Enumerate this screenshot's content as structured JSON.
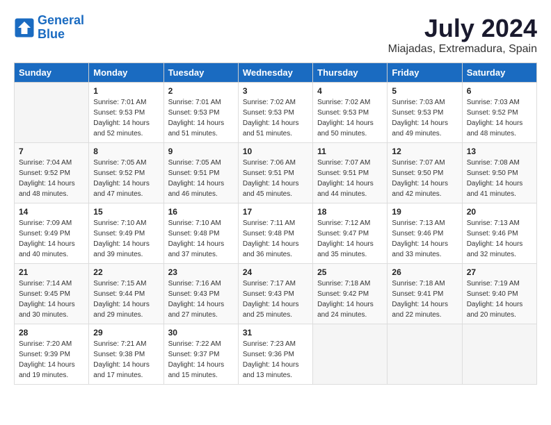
{
  "logo": {
    "line1": "General",
    "line2": "Blue"
  },
  "title": "July 2024",
  "subtitle": "Miajadas, Extremadura, Spain",
  "days_of_week": [
    "Sunday",
    "Monday",
    "Tuesday",
    "Wednesday",
    "Thursday",
    "Friday",
    "Saturday"
  ],
  "weeks": [
    [
      {
        "day": "",
        "sunrise": "",
        "sunset": "",
        "daylight": ""
      },
      {
        "day": "1",
        "sunrise": "Sunrise: 7:01 AM",
        "sunset": "Sunset: 9:53 PM",
        "daylight": "Daylight: 14 hours and 52 minutes."
      },
      {
        "day": "2",
        "sunrise": "Sunrise: 7:01 AM",
        "sunset": "Sunset: 9:53 PM",
        "daylight": "Daylight: 14 hours and 51 minutes."
      },
      {
        "day": "3",
        "sunrise": "Sunrise: 7:02 AM",
        "sunset": "Sunset: 9:53 PM",
        "daylight": "Daylight: 14 hours and 51 minutes."
      },
      {
        "day": "4",
        "sunrise": "Sunrise: 7:02 AM",
        "sunset": "Sunset: 9:53 PM",
        "daylight": "Daylight: 14 hours and 50 minutes."
      },
      {
        "day": "5",
        "sunrise": "Sunrise: 7:03 AM",
        "sunset": "Sunset: 9:53 PM",
        "daylight": "Daylight: 14 hours and 49 minutes."
      },
      {
        "day": "6",
        "sunrise": "Sunrise: 7:03 AM",
        "sunset": "Sunset: 9:52 PM",
        "daylight": "Daylight: 14 hours and 48 minutes."
      }
    ],
    [
      {
        "day": "7",
        "sunrise": "Sunrise: 7:04 AM",
        "sunset": "Sunset: 9:52 PM",
        "daylight": "Daylight: 14 hours and 48 minutes."
      },
      {
        "day": "8",
        "sunrise": "Sunrise: 7:05 AM",
        "sunset": "Sunset: 9:52 PM",
        "daylight": "Daylight: 14 hours and 47 minutes."
      },
      {
        "day": "9",
        "sunrise": "Sunrise: 7:05 AM",
        "sunset": "Sunset: 9:51 PM",
        "daylight": "Daylight: 14 hours and 46 minutes."
      },
      {
        "day": "10",
        "sunrise": "Sunrise: 7:06 AM",
        "sunset": "Sunset: 9:51 PM",
        "daylight": "Daylight: 14 hours and 45 minutes."
      },
      {
        "day": "11",
        "sunrise": "Sunrise: 7:07 AM",
        "sunset": "Sunset: 9:51 PM",
        "daylight": "Daylight: 14 hours and 44 minutes."
      },
      {
        "day": "12",
        "sunrise": "Sunrise: 7:07 AM",
        "sunset": "Sunset: 9:50 PM",
        "daylight": "Daylight: 14 hours and 42 minutes."
      },
      {
        "day": "13",
        "sunrise": "Sunrise: 7:08 AM",
        "sunset": "Sunset: 9:50 PM",
        "daylight": "Daylight: 14 hours and 41 minutes."
      }
    ],
    [
      {
        "day": "14",
        "sunrise": "Sunrise: 7:09 AM",
        "sunset": "Sunset: 9:49 PM",
        "daylight": "Daylight: 14 hours and 40 minutes."
      },
      {
        "day": "15",
        "sunrise": "Sunrise: 7:10 AM",
        "sunset": "Sunset: 9:49 PM",
        "daylight": "Daylight: 14 hours and 39 minutes."
      },
      {
        "day": "16",
        "sunrise": "Sunrise: 7:10 AM",
        "sunset": "Sunset: 9:48 PM",
        "daylight": "Daylight: 14 hours and 37 minutes."
      },
      {
        "day": "17",
        "sunrise": "Sunrise: 7:11 AM",
        "sunset": "Sunset: 9:48 PM",
        "daylight": "Daylight: 14 hours and 36 minutes."
      },
      {
        "day": "18",
        "sunrise": "Sunrise: 7:12 AM",
        "sunset": "Sunset: 9:47 PM",
        "daylight": "Daylight: 14 hours and 35 minutes."
      },
      {
        "day": "19",
        "sunrise": "Sunrise: 7:13 AM",
        "sunset": "Sunset: 9:46 PM",
        "daylight": "Daylight: 14 hours and 33 minutes."
      },
      {
        "day": "20",
        "sunrise": "Sunrise: 7:13 AM",
        "sunset": "Sunset: 9:46 PM",
        "daylight": "Daylight: 14 hours and 32 minutes."
      }
    ],
    [
      {
        "day": "21",
        "sunrise": "Sunrise: 7:14 AM",
        "sunset": "Sunset: 9:45 PM",
        "daylight": "Daylight: 14 hours and 30 minutes."
      },
      {
        "day": "22",
        "sunrise": "Sunrise: 7:15 AM",
        "sunset": "Sunset: 9:44 PM",
        "daylight": "Daylight: 14 hours and 29 minutes."
      },
      {
        "day": "23",
        "sunrise": "Sunrise: 7:16 AM",
        "sunset": "Sunset: 9:43 PM",
        "daylight": "Daylight: 14 hours and 27 minutes."
      },
      {
        "day": "24",
        "sunrise": "Sunrise: 7:17 AM",
        "sunset": "Sunset: 9:43 PM",
        "daylight": "Daylight: 14 hours and 25 minutes."
      },
      {
        "day": "25",
        "sunrise": "Sunrise: 7:18 AM",
        "sunset": "Sunset: 9:42 PM",
        "daylight": "Daylight: 14 hours and 24 minutes."
      },
      {
        "day": "26",
        "sunrise": "Sunrise: 7:18 AM",
        "sunset": "Sunset: 9:41 PM",
        "daylight": "Daylight: 14 hours and 22 minutes."
      },
      {
        "day": "27",
        "sunrise": "Sunrise: 7:19 AM",
        "sunset": "Sunset: 9:40 PM",
        "daylight": "Daylight: 14 hours and 20 minutes."
      }
    ],
    [
      {
        "day": "28",
        "sunrise": "Sunrise: 7:20 AM",
        "sunset": "Sunset: 9:39 PM",
        "daylight": "Daylight: 14 hours and 19 minutes."
      },
      {
        "day": "29",
        "sunrise": "Sunrise: 7:21 AM",
        "sunset": "Sunset: 9:38 PM",
        "daylight": "Daylight: 14 hours and 17 minutes."
      },
      {
        "day": "30",
        "sunrise": "Sunrise: 7:22 AM",
        "sunset": "Sunset: 9:37 PM",
        "daylight": "Daylight: 14 hours and 15 minutes."
      },
      {
        "day": "31",
        "sunrise": "Sunrise: 7:23 AM",
        "sunset": "Sunset: 9:36 PM",
        "daylight": "Daylight: 14 hours and 13 minutes."
      },
      {
        "day": "",
        "sunrise": "",
        "sunset": "",
        "daylight": ""
      },
      {
        "day": "",
        "sunrise": "",
        "sunset": "",
        "daylight": ""
      },
      {
        "day": "",
        "sunrise": "",
        "sunset": "",
        "daylight": ""
      }
    ]
  ]
}
